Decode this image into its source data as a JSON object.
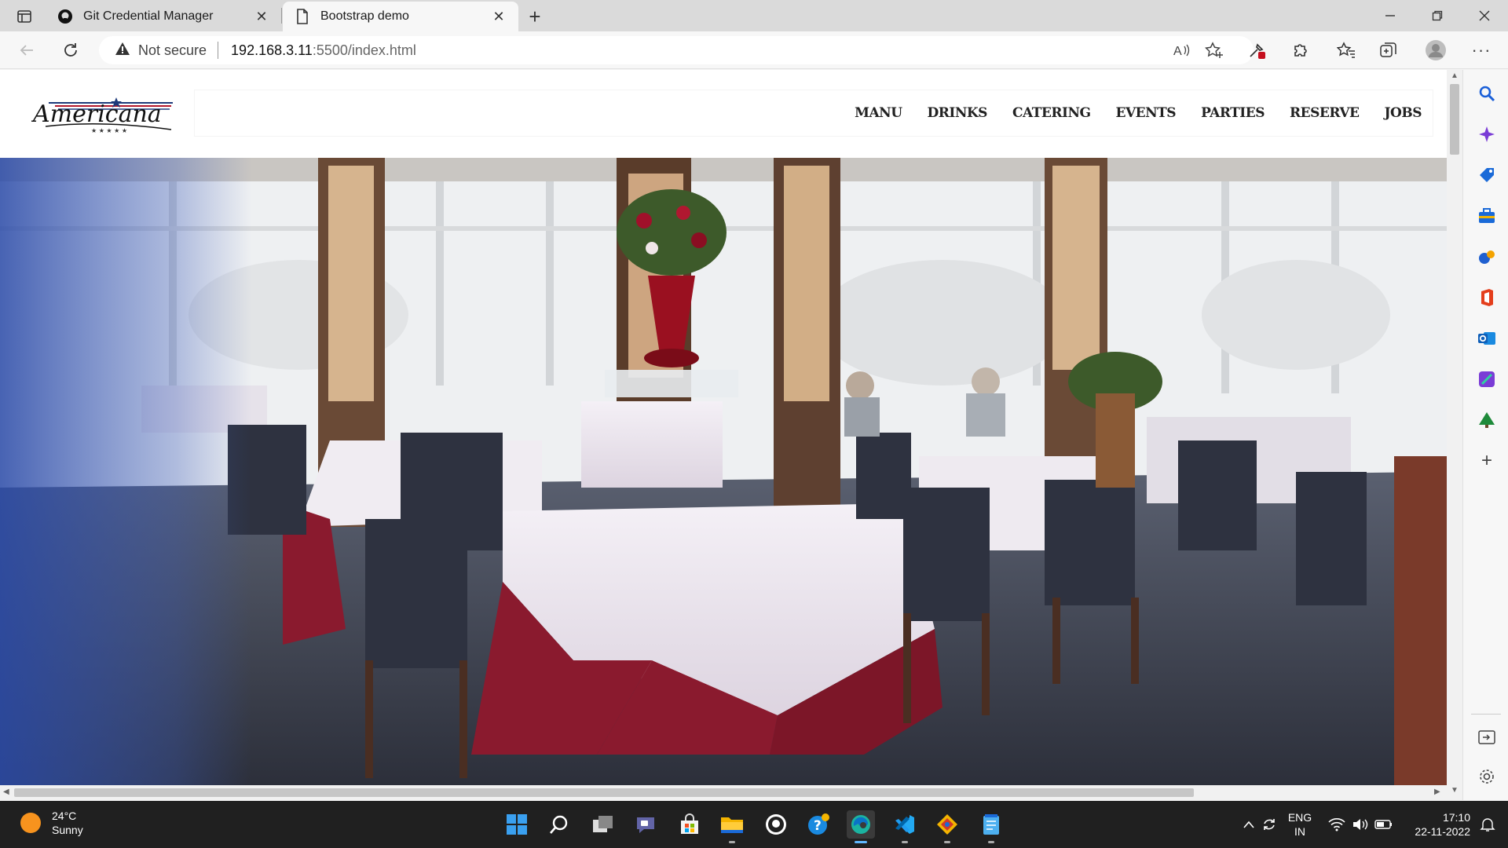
{
  "browser": {
    "tabs": [
      {
        "title": "Git Credential Manager",
        "favicon": "github-icon",
        "active": false
      },
      {
        "title": "Bootstrap demo",
        "favicon": "page-icon",
        "active": true
      }
    ],
    "security_label": "Not secure",
    "url_host": "192.168.3.11",
    "url_path": ":5500/index.html"
  },
  "site": {
    "logo_text": "Americana",
    "nav_links": [
      "MANU",
      "DRINKS",
      "CATERING",
      "EVENTS",
      "PARTIES",
      "RESERVE",
      "JOBS"
    ]
  },
  "taskbar": {
    "weather_temp": "24°C",
    "weather_desc": "Sunny",
    "lang_primary": "ENG",
    "lang_secondary": "IN",
    "time": "17:10",
    "date": "22-11-2022"
  },
  "colors": {
    "accent_edge": "#0078d4",
    "taskbar_bg": "#202020",
    "tablecloth_red": "#8a1a2e"
  }
}
